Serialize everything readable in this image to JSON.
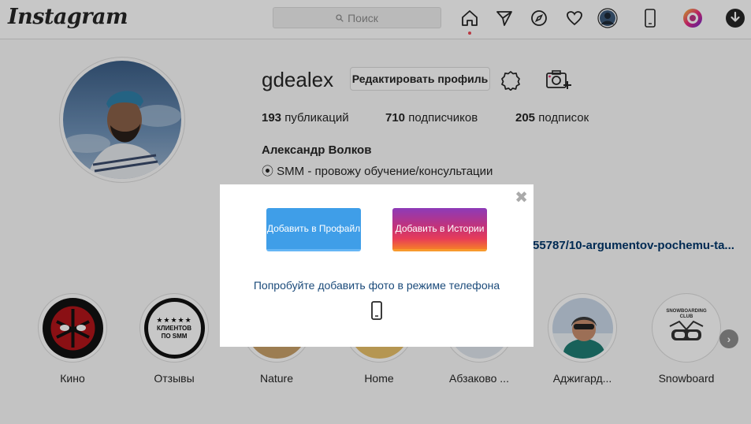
{
  "header": {
    "logo": "Instagram",
    "search_placeholder": "Поиск"
  },
  "profile": {
    "username": "gdealex",
    "edit_button": "Редактировать профиль",
    "stats": [
      {
        "count": "193",
        "label": "публикаций"
      },
      {
        "count": "710",
        "label": "подписчиков"
      },
      {
        "count": "205",
        "label": "подписок"
      }
    ],
    "full_name": "Александр Волков",
    "bio": "⦿ SMM - провожу обучение/консультации",
    "link_fragment": "55787/10-argumentov-pochemu-ta..."
  },
  "highlights": [
    {
      "label": "Кино"
    },
    {
      "label": "Отзывы",
      "badge_text": "КЛИЕНТОВ ПО SMM"
    },
    {
      "label": "Nature"
    },
    {
      "label": "Home"
    },
    {
      "label": "Абзаково ..."
    },
    {
      "label": "Аджигард..."
    },
    {
      "label": "Snowboard",
      "badge_text": "SNOWBOARDING CLUB"
    }
  ],
  "modal": {
    "add_profile": "Добавить в Профайл",
    "add_story": "Добавить в Истории",
    "try_phone": "Попробуйте добавить фото в режиме телефона",
    "close": "✖"
  },
  "colors": {
    "accent_blue": "#3f9ee8",
    "notification": "#ed4956",
    "link": "#00376b"
  }
}
